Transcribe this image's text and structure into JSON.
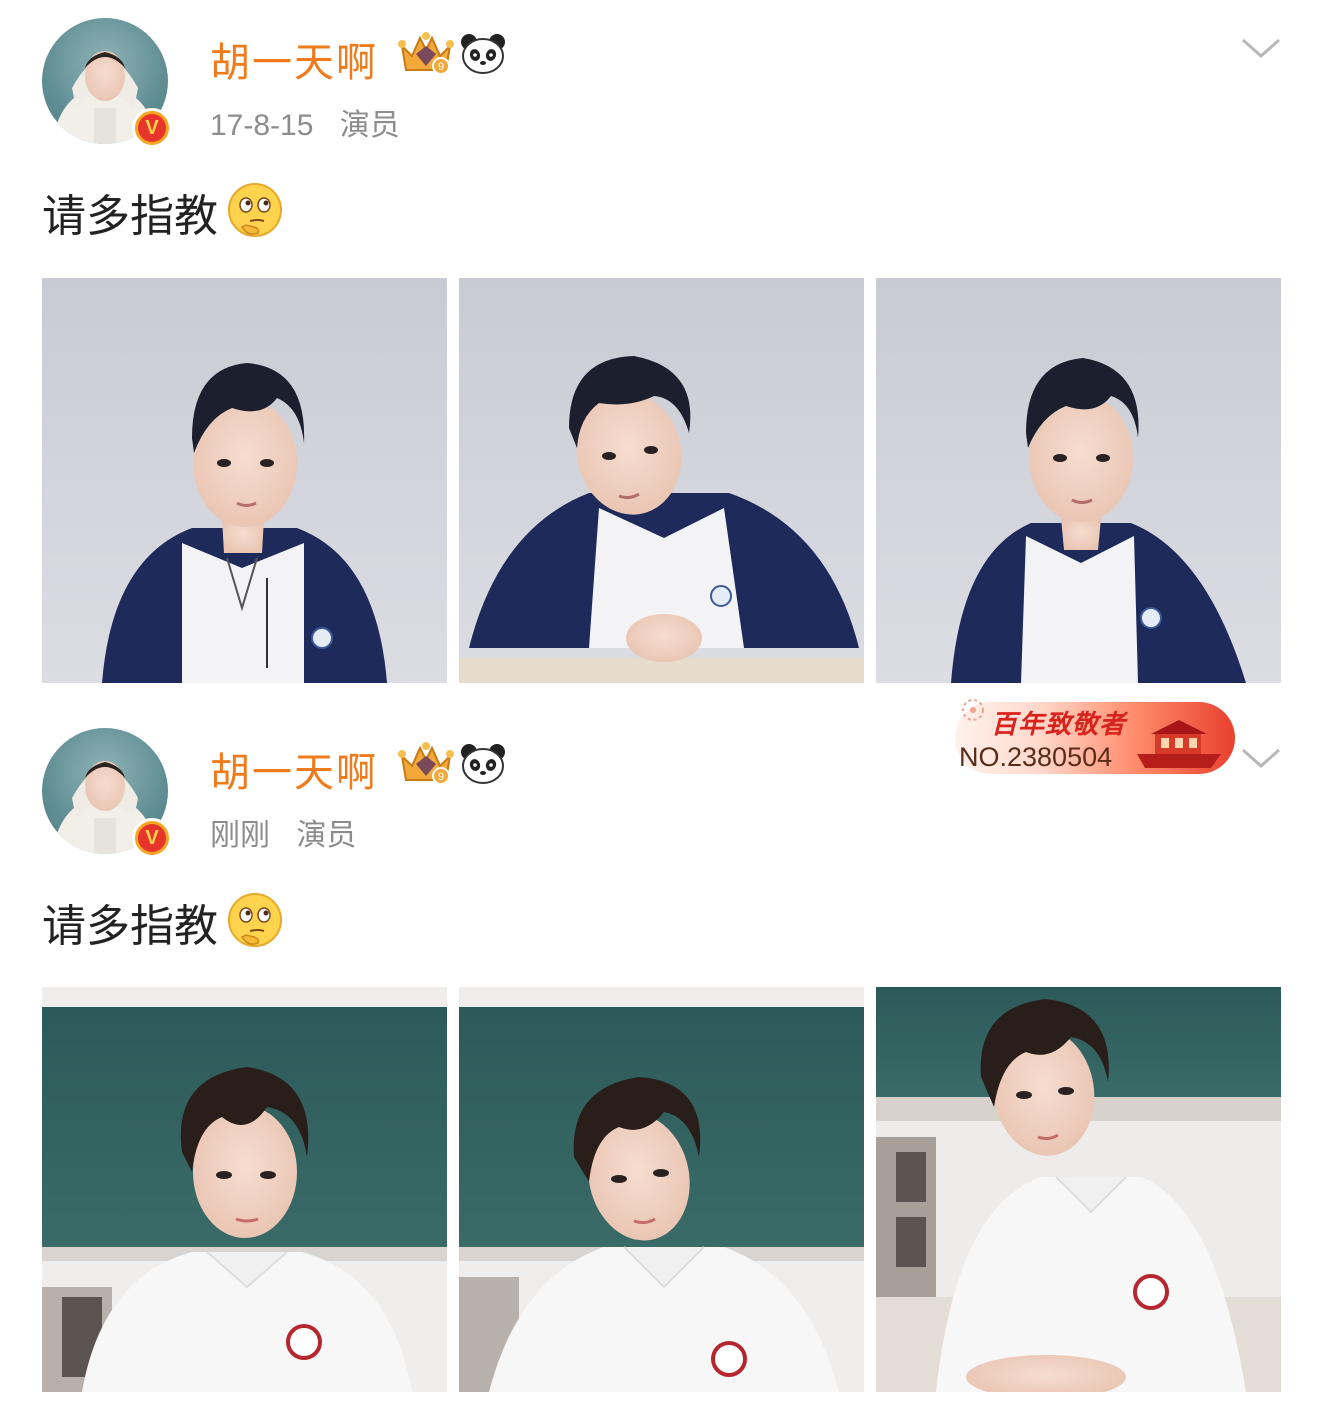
{
  "posts": [
    {
      "username": "胡一天啊",
      "time": "17-8-15",
      "source": "演员",
      "text": "请多指教",
      "level_badge": "9",
      "icons": [
        "crown-badge-icon",
        "panda-icon",
        "chevron-down-icon",
        "thinking-emoji-icon",
        "verified-v-icon"
      ],
      "photos": [
        "photo-1",
        "photo-2",
        "photo-3"
      ]
    },
    {
      "username": "胡一天啊",
      "time": "刚刚",
      "source": "演员",
      "text": "请多指教",
      "level_badge": "9",
      "icons": [
        "crown-badge-icon",
        "panda-icon",
        "chevron-down-icon",
        "thinking-emoji-icon",
        "verified-v-icon"
      ],
      "photos": [
        "photo-1",
        "photo-2",
        "photo-3"
      ]
    }
  ],
  "fan_badge": {
    "title": "百年致敬者",
    "number": "NO.2380504"
  },
  "colors": {
    "username": "#f07b1d",
    "meta": "#8c8c8c",
    "verified": "#e8352b",
    "badge_red": "#d8231c"
  },
  "verified_mark": "V"
}
